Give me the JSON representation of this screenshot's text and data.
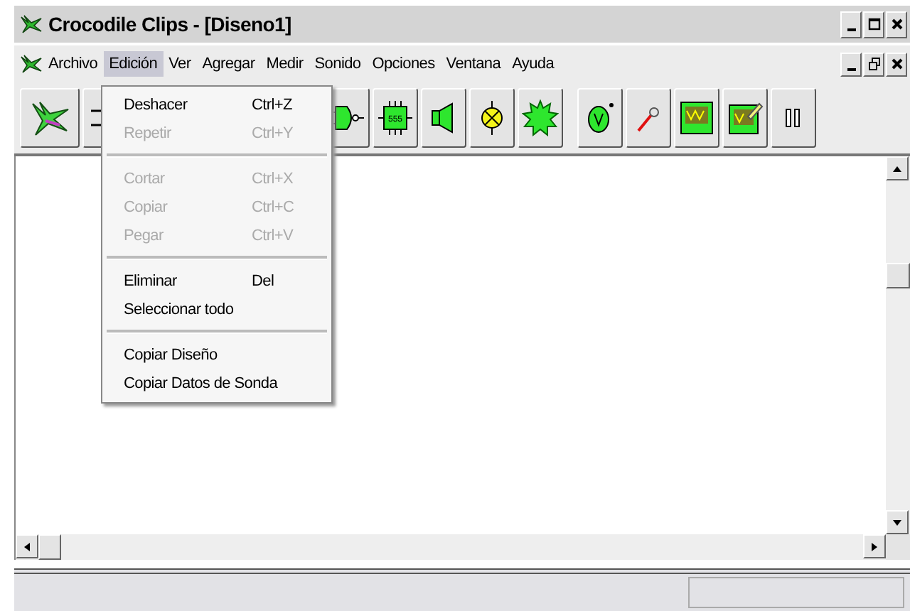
{
  "window": {
    "title": "Crocodile Clips - [Diseno1]"
  },
  "menu_bar": [
    {
      "label": "Archivo",
      "selected": false
    },
    {
      "label": "Edición",
      "selected": true
    },
    {
      "label": "Ver",
      "selected": false
    },
    {
      "label": "Agregar",
      "selected": false
    },
    {
      "label": "Medir",
      "selected": false
    },
    {
      "label": "Sonido",
      "selected": false
    },
    {
      "label": "Opciones",
      "selected": false
    },
    {
      "label": "Ventana",
      "selected": false
    },
    {
      "label": "Ayuda",
      "selected": false
    }
  ],
  "edit_menu": [
    {
      "kind": "item",
      "label": "Deshacer",
      "shortcut": "Ctrl+Z",
      "disabled": false
    },
    {
      "kind": "item",
      "label": "Repetir",
      "shortcut": "Ctrl+Y",
      "disabled": true
    },
    {
      "kind": "separator"
    },
    {
      "kind": "item",
      "label": "Cortar",
      "shortcut": "Ctrl+X",
      "disabled": true
    },
    {
      "kind": "item",
      "label": "Copiar",
      "shortcut": "Ctrl+C",
      "disabled": true
    },
    {
      "kind": "item",
      "label": "Pegar",
      "shortcut": "Ctrl+V",
      "disabled": true
    },
    {
      "kind": "separator"
    },
    {
      "kind": "item",
      "label": "Eliminar",
      "shortcut": "Del",
      "disabled": false
    },
    {
      "kind": "item",
      "label": "Seleccionar todo",
      "disabled": false
    },
    {
      "kind": "separator"
    },
    {
      "kind": "item",
      "label": "Copiar Diseño",
      "disabled": false
    },
    {
      "kind": "item",
      "label": "Copiar Datos de Sonda",
      "disabled": false
    }
  ],
  "toolbar": {
    "chip_label": "555"
  }
}
